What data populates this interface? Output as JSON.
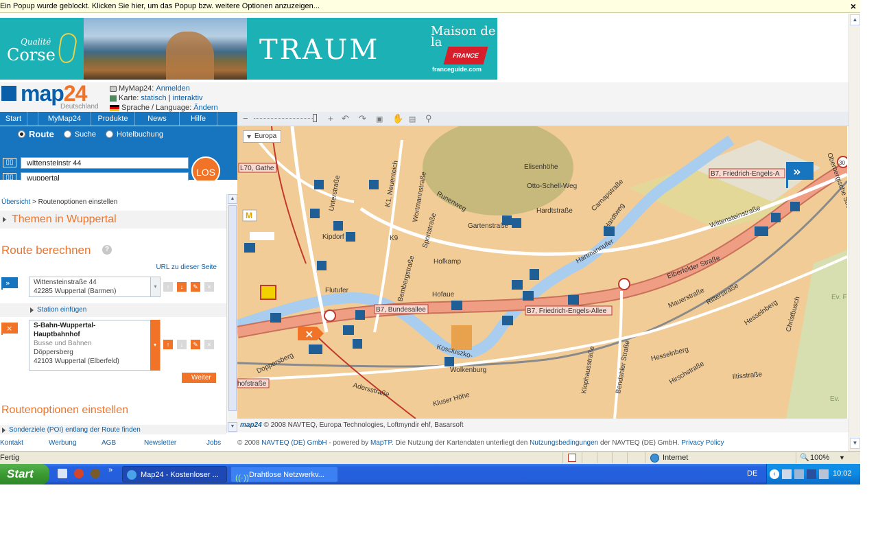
{
  "popup": {
    "message": "Ein Popup wurde geblockt. Klicken Sie hier, um das Popup bzw. weitere Optionen anzuzeigen...",
    "close": "×"
  },
  "banner": {
    "corse_top": "Qualité",
    "corse_main": "Corse",
    "traum": "TRAUM",
    "maison": "Maison de la",
    "france": "FRANCE",
    "site": "franceguide.com"
  },
  "header": {
    "logo_main": "map",
    "logo_num": "24",
    "logo_country": "Deutschland",
    "mymap_label": "MyMap24:",
    "mymap_link": "Anmelden",
    "karte_label": "Karte:",
    "karte_static": "statisch",
    "karte_sep": "|",
    "karte_interactive": "interaktiv",
    "lang_label": "Sprache / Language:",
    "lang_link": "Ändern"
  },
  "nav": [
    "Start",
    "MyMap24",
    "Produkte",
    "News",
    "Hilfe"
  ],
  "search": {
    "radio_route": "Route",
    "radio_suche": "Suche",
    "radio_hotel": "Hotelbuchung",
    "from_value": "wittensteinstr 44",
    "to_value": "wuppertal",
    "go": "LOS"
  },
  "panel": {
    "crumb_link": "Übersicht",
    "crumb_sep": " > ",
    "crumb_current": "Routenoptionen einstellen",
    "themen": "Themen in Wuppertal",
    "route_title": "Route berechnen",
    "help": "?",
    "url_link": "URL zu dieser Seite",
    "start_line1": "Wittensteinstraße 44",
    "start_line2": "42285 Wuppertal (Barmen)",
    "station": "Station einfügen",
    "dest_line1": "S-Bahn-Wuppertal-",
    "dest_line2": "Hauptbahnhof",
    "dest_line3": "Busse und Bahnen",
    "dest_line4": "Döppersberg",
    "dest_line5": "42103 Wuppertal (Elberfeld)",
    "weiter": "Weiter",
    "options_title": "Routenoptionen einstellen",
    "poi": "Sonderziele (POI) entlang der Route finden"
  },
  "map": {
    "region_btn": "Europa",
    "labels": {
      "l70": "L70, Gathe",
      "b7_top": "B7, Friedrich-Engels-A",
      "b7_mid": "B7, Bundesallee",
      "b7_right": "B7, Friedrich-Engels-Allee",
      "elisenhohe": "Elisenhöhe",
      "otto": "Otto-Schell-Weg",
      "hardtstr": "Hardtstraße",
      "gartenstr": "Gartenstraße",
      "hardtweg": "Hardtweg",
      "carnap": "Carnapstraße",
      "wittenstein": "Wittensteinstraße",
      "hartmannufer": "Hartmannufer",
      "elberfelder": "Elberfelder Straße",
      "mauer": "Mauerstraße",
      "ritter": "Ritterstraße",
      "hesselnberg1": "Hesselnberg",
      "christbusch": "Christbusch",
      "hofkamp": "Hofkamp",
      "wortmann": "Wortmannstraße",
      "sport": "Sportstraße",
      "runenweg": "Runenweg",
      "bemberg": "Bembergstraße",
      "hofaue": "Hofaue",
      "flutufer": "Flutufer",
      "kipdorf": "Kipdorf",
      "kosciuszko": "Kosciuszko-",
      "wolkenburg": "Wolkenburg",
      "aders": "Adersstraße",
      "kluser": "Kluser Höhe",
      "hofstr": "hofstraße",
      "doppersberg": "Doppersberg",
      "klophaus": "Klophausstraße",
      "bendahler": "Bendahler Straße",
      "hesselnberg2": "Hesselnberg",
      "hirsch": "Hirschstraße",
      "iltis": "Iltisstraße",
      "ev1": "Ev. F",
      "ev2": "Ev.",
      "europa_s": "Elisenhöhe",
      "neuenteich": "K1, Neuenteich",
      "unterstr": "Unterstraße",
      "k9": "K9",
      "ohligs": "Obe",
      "oberbergische": "Oberbergische Straße",
      "sign30": "30"
    }
  },
  "mapcopy": {
    "brand": "map24",
    "text": "© 2008 NAVTEQ, Europa Technologies, Loftmyndir ehf, Basarsoft"
  },
  "footer": {
    "links": [
      "Kontakt",
      "Werbung",
      "AGB",
      "Newsletter",
      "Jobs"
    ],
    "copy_pre": "© 2008",
    "navteq": "NAVTEQ (DE) GmbH",
    "powered": "- powered by",
    "maptp": "MapTP",
    "mid": ". Die Nutzung der Kartendaten unterliegt den",
    "nb": "Nutzungsbedingungen",
    "post": "der NAVTEQ (DE) GmbH.",
    "privacy": "Privacy Policy"
  },
  "statusbar": {
    "state": "Fertig",
    "zone": "Internet",
    "zoom": "100%"
  },
  "taskbar": {
    "start": "Start",
    "task1": "Map24 - Kostenloser ...",
    "task2": "Drahtlose Netzwerkv...",
    "lang": "DE",
    "time": "10:02"
  },
  "colors": {
    "brand_blue": "#1775bf",
    "accent_orange": "#f07328",
    "map_bg": "#f2cc97",
    "road_red": "#e8806a",
    "river": "#a9cdee"
  }
}
